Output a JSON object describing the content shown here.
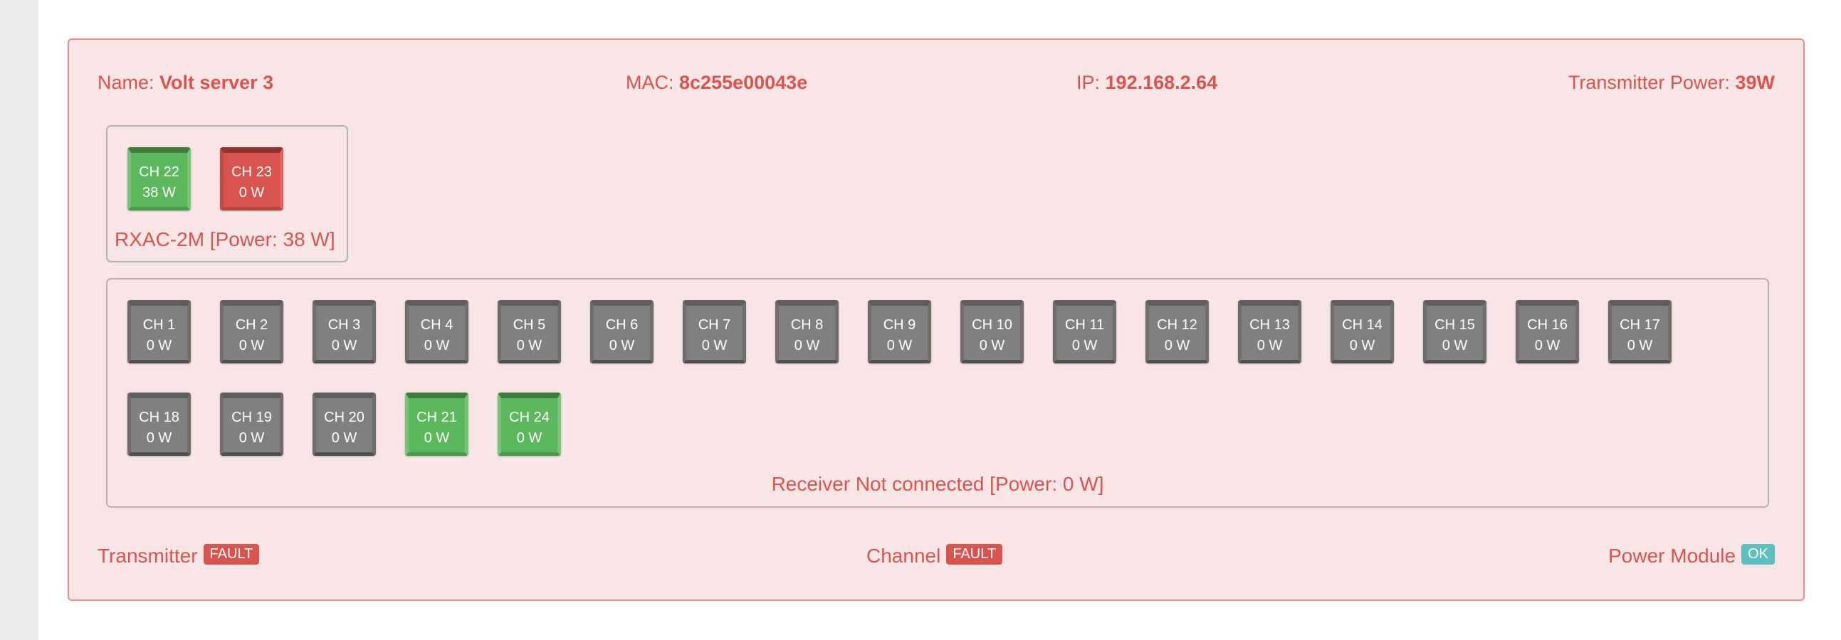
{
  "header": {
    "name_label": "Name:",
    "name_value": "Volt server 3",
    "mac_label": "MAC:",
    "mac_value": "8c255e00043e",
    "ip_label": "IP:",
    "ip_value": "192.168.2.64",
    "tx_power_label": "Transmitter Power:",
    "tx_power_value": "39W"
  },
  "receiver1": {
    "label": "RXAC-2M [Power: 38 W]",
    "channels": [
      {
        "name": "CH 22",
        "power": "38 W",
        "state": "green"
      },
      {
        "name": "CH 23",
        "power": "0 W",
        "state": "red"
      }
    ]
  },
  "receiver2": {
    "label": "Receiver Not connected [Power: 0 W]",
    "channels": [
      {
        "name": "CH 1",
        "power": "0 W",
        "state": "gray"
      },
      {
        "name": "CH 2",
        "power": "0 W",
        "state": "gray"
      },
      {
        "name": "CH 3",
        "power": "0 W",
        "state": "gray"
      },
      {
        "name": "CH 4",
        "power": "0 W",
        "state": "gray"
      },
      {
        "name": "CH 5",
        "power": "0 W",
        "state": "gray"
      },
      {
        "name": "CH 6",
        "power": "0 W",
        "state": "gray"
      },
      {
        "name": "CH 7",
        "power": "0 W",
        "state": "gray"
      },
      {
        "name": "CH 8",
        "power": "0 W",
        "state": "gray"
      },
      {
        "name": "CH 9",
        "power": "0 W",
        "state": "gray"
      },
      {
        "name": "CH 10",
        "power": "0 W",
        "state": "gray"
      },
      {
        "name": "CH 11",
        "power": "0 W",
        "state": "gray"
      },
      {
        "name": "CH 12",
        "power": "0 W",
        "state": "gray"
      },
      {
        "name": "CH 13",
        "power": "0 W",
        "state": "gray"
      },
      {
        "name": "CH 14",
        "power": "0 W",
        "state": "gray"
      },
      {
        "name": "CH 15",
        "power": "0 W",
        "state": "gray"
      },
      {
        "name": "CH 16",
        "power": "0 W",
        "state": "gray"
      },
      {
        "name": "CH 17",
        "power": "0 W",
        "state": "gray"
      },
      {
        "name": "CH 18",
        "power": "0 W",
        "state": "gray"
      },
      {
        "name": "CH 19",
        "power": "0 W",
        "state": "gray"
      },
      {
        "name": "CH 20",
        "power": "0 W",
        "state": "gray"
      },
      {
        "name": "CH 21",
        "power": "0 W",
        "state": "green"
      },
      {
        "name": "CH 24",
        "power": "0 W",
        "state": "green"
      }
    ]
  },
  "status": {
    "transmitter_label": "Transmitter",
    "transmitter_badge": "FAULT",
    "channel_label": "Channel",
    "channel_badge": "FAULT",
    "power_module_label": "Power Module",
    "power_module_badge": "OK"
  },
  "colors": {
    "accent": "#d9534f",
    "panel_bg": "#f8e6e6",
    "ok": "#5bc0be",
    "on": "#5cb85c",
    "off": "#808080"
  }
}
